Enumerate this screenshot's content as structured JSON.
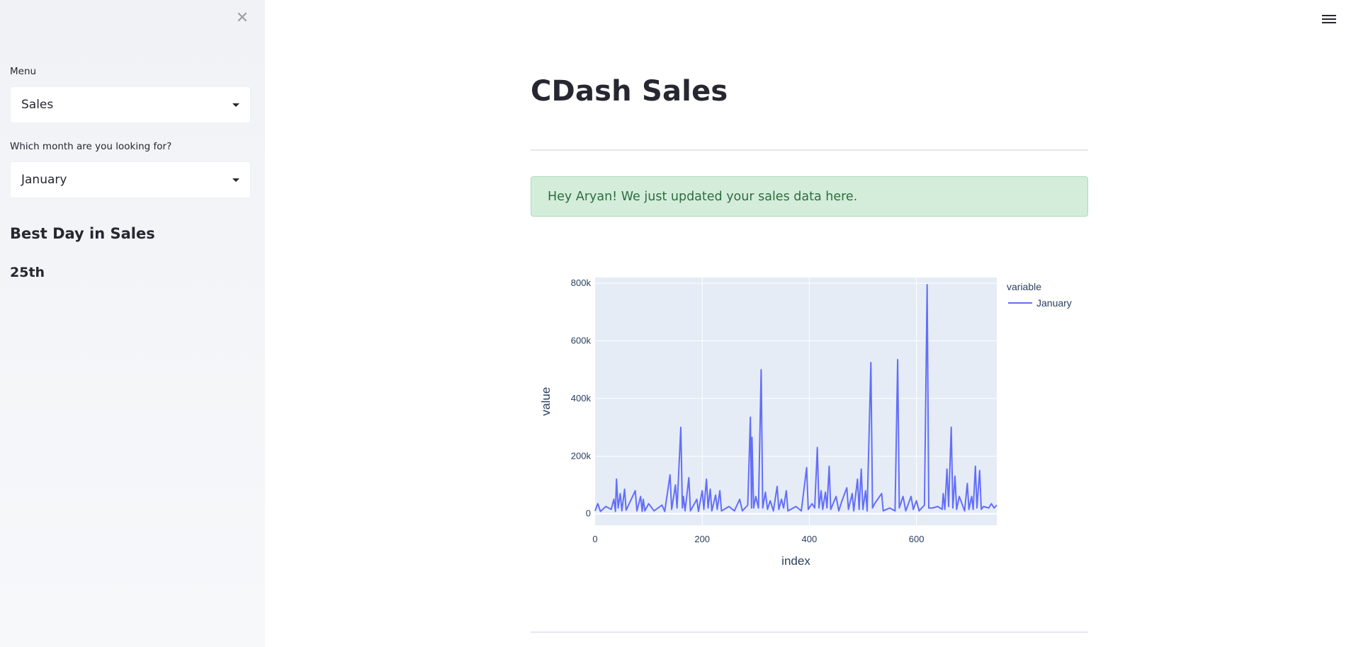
{
  "sidebar": {
    "close_glyph": "✕",
    "menu_label": "Menu",
    "menu_value": "Sales",
    "month_label": "Which month are you looking for?",
    "month_value": "January",
    "best_day_heading": "Best Day in Sales",
    "best_day_value": "25th"
  },
  "main": {
    "title": "CDash Sales",
    "alert": "Hey Aryan! We just updated your sales data here."
  },
  "colors": {
    "accent": "#636efa",
    "plot_bg": "#e5ecf6",
    "alert_bg": "#d4eddb",
    "alert_text": "#2e6d3f"
  },
  "chart_data": {
    "type": "line",
    "xlabel": "index",
    "ylabel": "value",
    "xlim": [
      0,
      750
    ],
    "ylim": [
      -40000,
      820000
    ],
    "x_ticks": [
      0,
      200,
      400,
      600
    ],
    "x_tick_labels": [
      "0",
      "200",
      "400",
      "600"
    ],
    "y_ticks": [
      0,
      200000,
      400000,
      600000,
      800000
    ],
    "y_tick_labels": [
      "0",
      "200k",
      "400k",
      "600k",
      "800k"
    ],
    "legend_title": "variable",
    "legend_position": "top-right",
    "grid": true,
    "series": [
      {
        "name": "January",
        "color": "#636efa",
        "points": [
          [
            0,
            10000
          ],
          [
            5,
            35000
          ],
          [
            10,
            8000
          ],
          [
            20,
            25000
          ],
          [
            30,
            15000
          ],
          [
            35,
            50000
          ],
          [
            38,
            8000
          ],
          [
            40,
            120000
          ],
          [
            43,
            20000
          ],
          [
            47,
            70000
          ],
          [
            50,
            10000
          ],
          [
            55,
            85000
          ],
          [
            58,
            12000
          ],
          [
            75,
            80000
          ],
          [
            78,
            10000
          ],
          [
            85,
            60000
          ],
          [
            88,
            8000
          ],
          [
            90,
            50000
          ],
          [
            93,
            10000
          ],
          [
            100,
            35000
          ],
          [
            110,
            10000
          ],
          [
            125,
            30000
          ],
          [
            130,
            8000
          ],
          [
            140,
            135000
          ],
          [
            143,
            15000
          ],
          [
            150,
            100000
          ],
          [
            153,
            20000
          ],
          [
            160,
            300000
          ],
          [
            163,
            20000
          ],
          [
            165,
            60000
          ],
          [
            168,
            10000
          ],
          [
            175,
            125000
          ],
          [
            178,
            10000
          ],
          [
            190,
            50000
          ],
          [
            193,
            8000
          ],
          [
            200,
            80000
          ],
          [
            203,
            15000
          ],
          [
            208,
            120000
          ],
          [
            211,
            20000
          ],
          [
            215,
            85000
          ],
          [
            218,
            10000
          ],
          [
            225,
            65000
          ],
          [
            228,
            15000
          ],
          [
            233,
            80000
          ],
          [
            236,
            10000
          ],
          [
            250,
            25000
          ],
          [
            260,
            10000
          ],
          [
            270,
            50000
          ],
          [
            275,
            10000
          ],
          [
            285,
            30000
          ],
          [
            290,
            335000
          ],
          [
            292,
            20000
          ],
          [
            293,
            265000
          ],
          [
            296,
            20000
          ],
          [
            300,
            60000
          ],
          [
            305,
            20000
          ],
          [
            310,
            500000
          ],
          [
            313,
            20000
          ],
          [
            318,
            75000
          ],
          [
            322,
            15000
          ],
          [
            327,
            45000
          ],
          [
            333,
            10000
          ],
          [
            340,
            95000
          ],
          [
            343,
            15000
          ],
          [
            348,
            50000
          ],
          [
            352,
            20000
          ],
          [
            357,
            80000
          ],
          [
            360,
            10000
          ],
          [
            375,
            25000
          ],
          [
            385,
            10000
          ],
          [
            395,
            160000
          ],
          [
            398,
            15000
          ],
          [
            405,
            35000
          ],
          [
            410,
            20000
          ],
          [
            415,
            230000
          ],
          [
            418,
            20000
          ],
          [
            422,
            80000
          ],
          [
            425,
            15000
          ],
          [
            430,
            75000
          ],
          [
            433,
            20000
          ],
          [
            437,
            165000
          ],
          [
            440,
            15000
          ],
          [
            450,
            60000
          ],
          [
            455,
            10000
          ],
          [
            460,
            40000
          ],
          [
            470,
            90000
          ],
          [
            473,
            15000
          ],
          [
            480,
            70000
          ],
          [
            483,
            10000
          ],
          [
            490,
            120000
          ],
          [
            493,
            15000
          ],
          [
            497,
            155000
          ],
          [
            500,
            15000
          ],
          [
            505,
            80000
          ],
          [
            508,
            10000
          ],
          [
            515,
            525000
          ],
          [
            518,
            20000
          ],
          [
            522,
            35000
          ],
          [
            535,
            70000
          ],
          [
            538,
            10000
          ],
          [
            550,
            20000
          ],
          [
            560,
            10000
          ],
          [
            565,
            535000
          ],
          [
            568,
            20000
          ],
          [
            575,
            60000
          ],
          [
            580,
            10000
          ],
          [
            590,
            60000
          ],
          [
            594,
            15000
          ],
          [
            600,
            45000
          ],
          [
            605,
            10000
          ],
          [
            615,
            30000
          ],
          [
            620,
            795000
          ],
          [
            623,
            20000
          ],
          [
            630,
            20000
          ],
          [
            640,
            25000
          ],
          [
            648,
            15000
          ],
          [
            650,
            70000
          ],
          [
            653,
            15000
          ],
          [
            657,
            155000
          ],
          [
            660,
            25000
          ],
          [
            665,
            300000
          ],
          [
            668,
            20000
          ],
          [
            672,
            130000
          ],
          [
            675,
            15000
          ],
          [
            680,
            60000
          ],
          [
            690,
            10000
          ],
          [
            695,
            105000
          ],
          [
            698,
            15000
          ],
          [
            703,
            60000
          ],
          [
            706,
            15000
          ],
          [
            710,
            165000
          ],
          [
            713,
            20000
          ],
          [
            718,
            150000
          ],
          [
            721,
            15000
          ],
          [
            725,
            25000
          ],
          [
            735,
            20000
          ],
          [
            740,
            35000
          ],
          [
            745,
            20000
          ],
          [
            750,
            30000
          ]
        ]
      }
    ]
  }
}
